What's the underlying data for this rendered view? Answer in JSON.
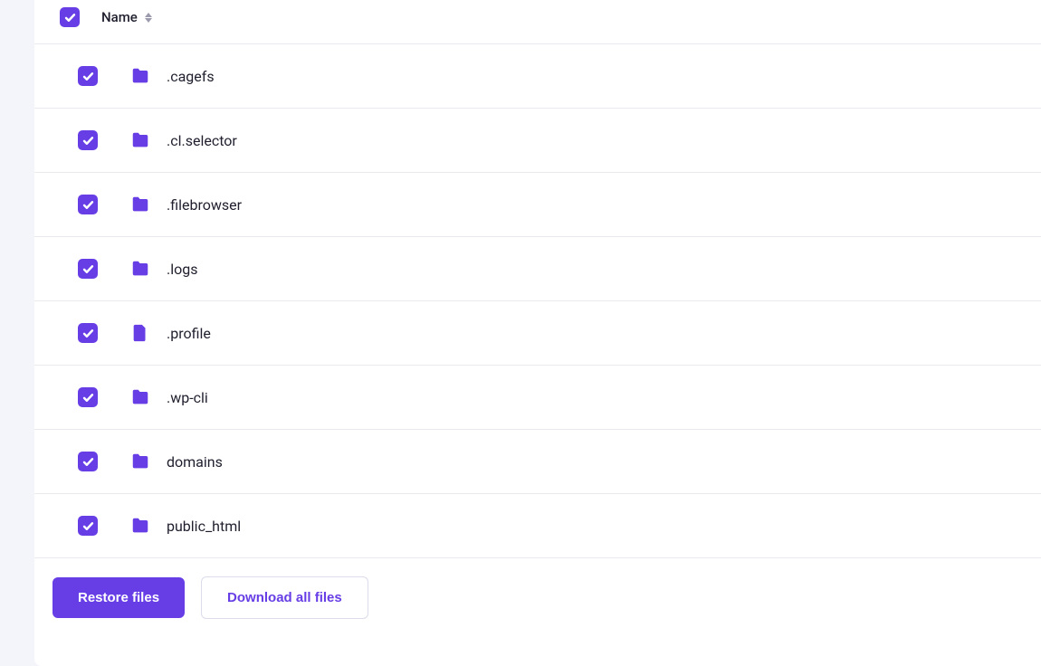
{
  "table": {
    "header": {
      "name_label": "Name"
    },
    "items": [
      {
        "name": ".cagefs",
        "type": "folder",
        "checked": true
      },
      {
        "name": ".cl.selector",
        "type": "folder",
        "checked": true
      },
      {
        "name": ".filebrowser",
        "type": "folder",
        "checked": true
      },
      {
        "name": ".logs",
        "type": "folder",
        "checked": true
      },
      {
        "name": ".profile",
        "type": "file",
        "checked": true
      },
      {
        "name": ".wp-cli",
        "type": "folder",
        "checked": true
      },
      {
        "name": "domains",
        "type": "folder",
        "checked": true
      },
      {
        "name": "public_html",
        "type": "folder",
        "checked": true
      }
    ]
  },
  "actions": {
    "restore_label": "Restore files",
    "download_label": "Download all files"
  },
  "colors": {
    "accent": "#673de6"
  }
}
